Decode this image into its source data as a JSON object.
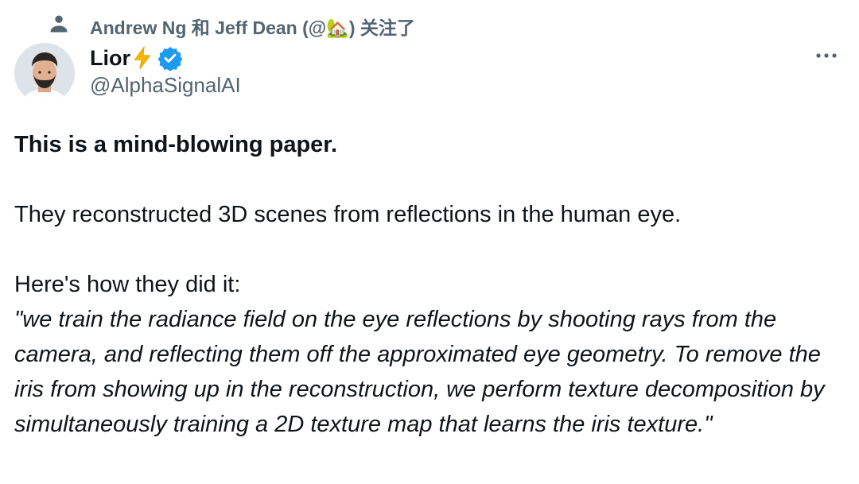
{
  "social_context": {
    "text": "Andrew Ng 和 Jeff Dean (@🏡) 关注了",
    "icon": "person-icon"
  },
  "author": {
    "display_name": "Lior",
    "emoji": "⚡",
    "verified": true,
    "verified_color": "#1d9bf0",
    "handle": "@AlphaSignalAI",
    "avatar_icon": "avatar-photo"
  },
  "more_menu": {
    "icon": "more-horizontal-icon"
  },
  "tweet": {
    "line1": "This is a mind-blowing paper.",
    "line2": "They reconstructed 3D scenes from reflections in the human eye.",
    "line3": "Here's how they did it:",
    "quote": "\"we train the radiance field on the eye reflections by shooting rays from the camera, and reflecting them off the approximated eye geometry. To remove the iris from showing up in the reconstruction, we perform texture decomposition by simultaneously training a 2D texture map that learns the iris texture.\""
  }
}
